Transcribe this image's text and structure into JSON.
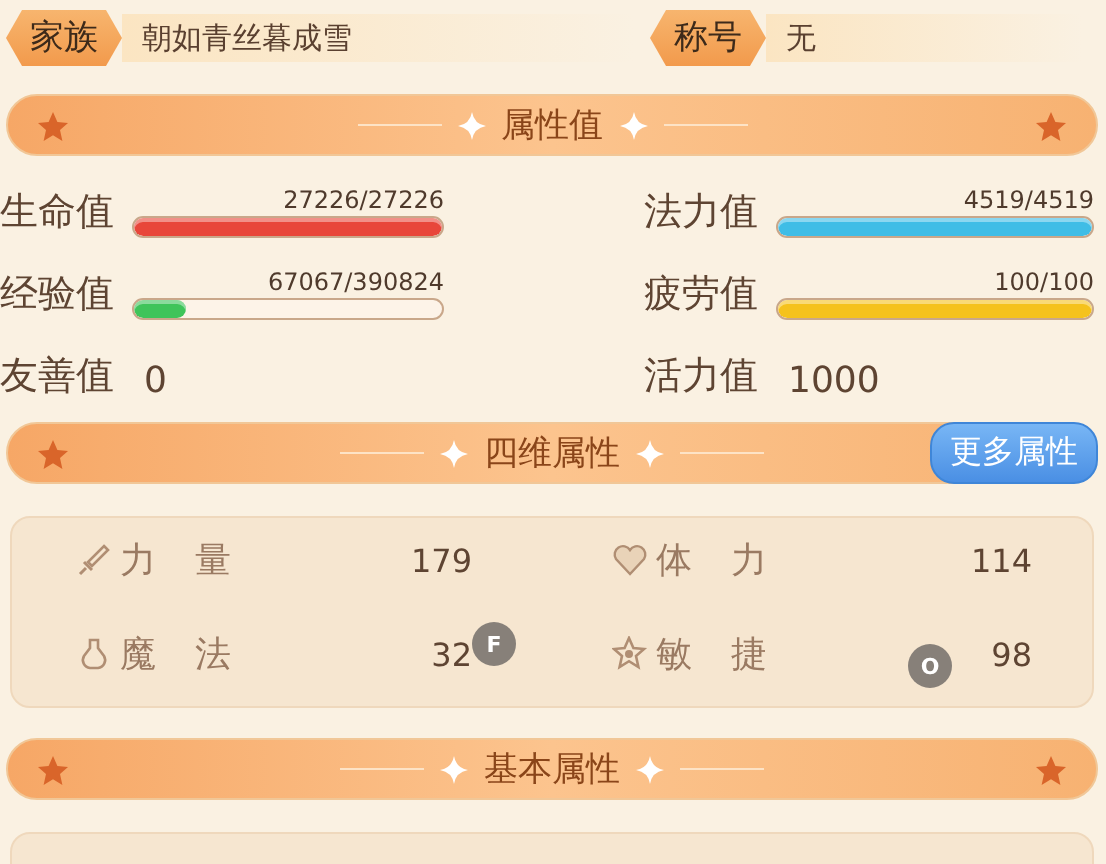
{
  "header": [
    {
      "label": "家族",
      "value": "朝如青丝暮成雪"
    },
    {
      "label": "称号",
      "value": "无"
    }
  ],
  "attributes": {
    "title": "属性值",
    "bars": [
      {
        "label": "生命值",
        "reading": "27226/27226",
        "level": 1,
        "color": "#e8463a"
      },
      {
        "label": "法力值",
        "reading": "4519/4519",
        "level": 1,
        "color": "#3fbde6"
      },
      {
        "label": "经验值",
        "reading": "67067/390824",
        "level": 0.17,
        "color": "#3fc45a"
      },
      {
        "label": "疲劳值",
        "reading": "100/100",
        "level": 1,
        "color": "#f5c21c"
      }
    ],
    "values": [
      {
        "label": "友善值",
        "value": "0"
      },
      {
        "label": "活力值",
        "value": "1000"
      }
    ]
  },
  "four_dimensions": {
    "title": "四维属性",
    "button": "更多属性",
    "stats": [
      {
        "kind": "sword",
        "label": "力 量",
        "value": "179"
      },
      {
        "kind": "heart",
        "label": "体 力",
        "value": "114"
      },
      {
        "kind": "potion",
        "label": "魔 法",
        "value": "32",
        "key_hint": "F"
      },
      {
        "kind": "flower",
        "label": "敏 捷",
        "value": "98",
        "key_hint": "O"
      }
    ]
  },
  "basic": {
    "title": "基本属性"
  }
}
